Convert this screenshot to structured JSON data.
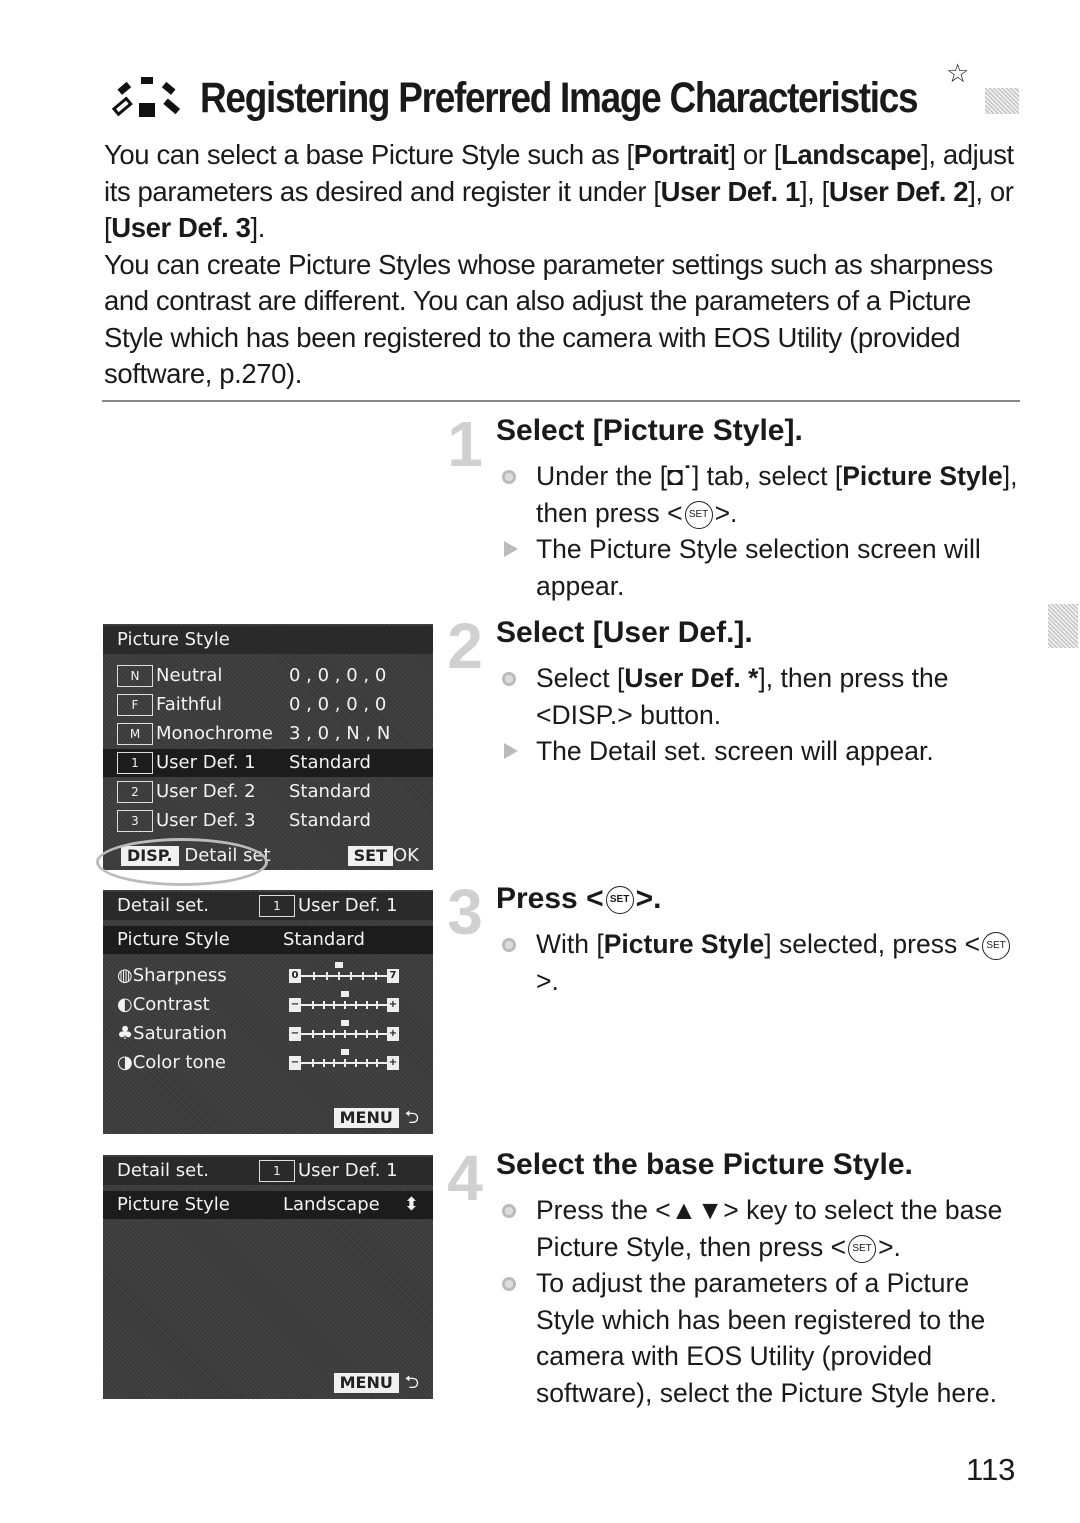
{
  "header": {
    "icon": "picture-style-icon",
    "title": "Registering Preferred Image Characteristics",
    "star": "☆"
  },
  "intro": {
    "p1_parts": [
      {
        "t": "You can select a base Picture Style such as [",
        "b": false
      },
      {
        "t": "Portrait",
        "b": true
      },
      {
        "t": "] or [",
        "b": false
      },
      {
        "t": "Landscape",
        "b": true
      },
      {
        "t": "], adjust its parameters as desired and register it under [",
        "b": false
      },
      {
        "t": "User Def. 1",
        "b": true
      },
      {
        "t": "], [",
        "b": false
      },
      {
        "t": "User Def. 2",
        "b": true
      },
      {
        "t": "], or [",
        "b": false
      },
      {
        "t": "User Def. 3",
        "b": true
      },
      {
        "t": "].",
        "b": false
      }
    ],
    "p2": "You can create Picture Styles whose parameter settings such as sharpness and contrast are different. You can also adjust the parameters of a Picture Style which has been registered to the camera with EOS Utility (provided software, p.270)."
  },
  "steps": [
    {
      "num": "1",
      "title": "Select [Picture Style].",
      "items": [
        {
          "type": "bullet",
          "parts": [
            {
              "t": "Under the [",
              "b": false
            },
            {
              "t": "◘˙",
              "b": true
            },
            {
              "t": "] tab, select [",
              "b": false
            },
            {
              "t": "Picture Style",
              "b": true
            },
            {
              "t": "], then press <",
              "b": false
            },
            {
              "t": "SET",
              "btn": true
            },
            {
              "t": ">.",
              "b": false
            }
          ]
        },
        {
          "type": "arrow",
          "parts": [
            {
              "t": "The Picture Style selection screen will appear.",
              "b": false
            }
          ]
        }
      ]
    },
    {
      "num": "2",
      "title": "Select [User Def.].",
      "items": [
        {
          "type": "bullet",
          "parts": [
            {
              "t": "Select [",
              "b": false
            },
            {
              "t": "User Def. *",
              "b": true
            },
            {
              "t": "], then press the <DISP.> button.",
              "b": false
            }
          ]
        },
        {
          "type": "arrow",
          "parts": [
            {
              "t": "The Detail set. screen will appear.",
              "b": false
            }
          ]
        }
      ]
    },
    {
      "num": "3",
      "title": "Press <SET>.",
      "items": [
        {
          "type": "bullet",
          "parts": [
            {
              "t": "With [",
              "b": false
            },
            {
              "t": "Picture Style",
              "b": true
            },
            {
              "t": "] selected, press <",
              "b": false
            },
            {
              "t": "SET",
              "btn": true
            },
            {
              "t": ">.",
              "b": false
            }
          ]
        }
      ]
    },
    {
      "num": "4",
      "title": "Select the base Picture Style.",
      "items": [
        {
          "type": "bullet",
          "parts": [
            {
              "t": "Press the <▲▼> key to select the base Picture Style, then press <",
              "b": false
            },
            {
              "t": "SET",
              "btn": true
            },
            {
              "t": ">.",
              "b": false
            }
          ]
        },
        {
          "type": "bullet",
          "parts": [
            {
              "t": "To adjust the parameters of a Picture Style which has been registered to the camera with EOS Utility (provided software), select the Picture Style here.",
              "b": false
            }
          ]
        }
      ]
    }
  ],
  "screen1": {
    "title": "Picture Style",
    "rows": [
      {
        "icon": "N",
        "name": "Neutral",
        "value": "0 , 0 , 0 , 0",
        "selected": false
      },
      {
        "icon": "F",
        "name": "Faithful",
        "value": "0 , 0 , 0 , 0",
        "selected": false
      },
      {
        "icon": "M",
        "name": "Monochrome",
        "value": "3 , 0 , N , N",
        "selected": false
      },
      {
        "icon": "1",
        "name": "User Def. 1",
        "value": "Standard",
        "selected": true
      },
      {
        "icon": "2",
        "name": "User Def. 2",
        "value": "Standard",
        "selected": false
      },
      {
        "icon": "3",
        "name": "User Def. 3",
        "value": "Standard",
        "selected": false
      }
    ],
    "disp_key": "DISP.",
    "disp_label": "Detail set",
    "set_key": "SET",
    "set_label": "OK"
  },
  "screen2": {
    "title": "Detail set.",
    "style_icon": "1",
    "style_name": "User Def. 1",
    "ps_label": "Picture Style",
    "ps_value": "Standard",
    "params": [
      {
        "name": "Sharpness",
        "icon": "◍",
        "min": "0",
        "max": "7",
        "value": 3,
        "range": [
          0,
          7
        ]
      },
      {
        "name": "Contrast",
        "icon": "◐",
        "min": "−",
        "max": "+",
        "value": 0,
        "range": [
          -4,
          4
        ]
      },
      {
        "name": "Saturation",
        "icon": "♣",
        "min": "−",
        "max": "+",
        "value": 0,
        "range": [
          -4,
          4
        ]
      },
      {
        "name": "Color tone",
        "icon": "◑",
        "min": "−",
        "max": "+",
        "value": 0,
        "range": [
          -4,
          4
        ]
      }
    ],
    "menu_key": "MENU",
    "back": "⮌"
  },
  "screen3": {
    "title": "Detail set.",
    "style_icon": "1",
    "style_name": "User Def. 1",
    "ps_label": "Picture Style",
    "ps_value": "Landscape",
    "updown": "⬍",
    "menu_key": "MENU",
    "back": "⮌"
  },
  "page_number": "113"
}
